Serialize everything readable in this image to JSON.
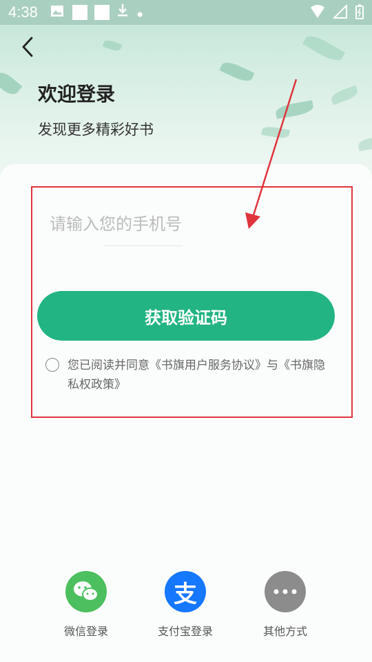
{
  "status_bar": {
    "time": "4:38"
  },
  "header": {
    "title": "欢迎登录",
    "subtitle": "发现更多精彩好书"
  },
  "form": {
    "phone_placeholder": "请输入您的手机号",
    "get_code_label": "获取验证码",
    "agreement_text": "您已阅读并同意《书旗用户服务协议》与《书旗隐私权政策》"
  },
  "social_login": [
    {
      "label": "微信登录",
      "icon": "wechat-icon",
      "color": "#4cbf5e"
    },
    {
      "label": "支付宝登录",
      "icon": "alipay-icon",
      "color": "#1677ff"
    },
    {
      "label": "其他方式",
      "icon": "more-icon",
      "color": "#8c8c8c"
    }
  ],
  "colors": {
    "accent": "#22b482",
    "annotation_red": "#e0343c"
  }
}
